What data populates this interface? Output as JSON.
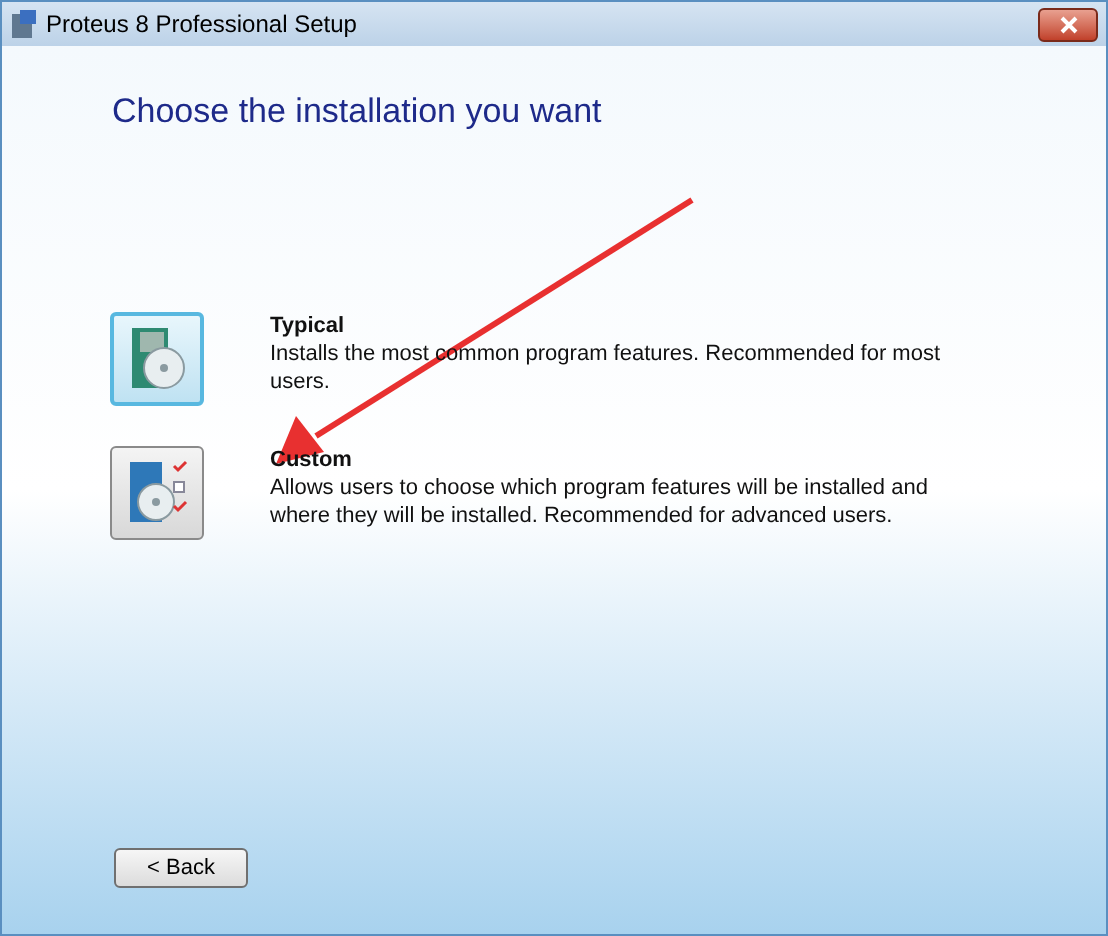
{
  "window": {
    "title": "Proteus 8 Professional Setup"
  },
  "heading": "Choose the installation you want",
  "options": [
    {
      "kind": "typical",
      "title": "Typical",
      "description": "Installs the most common program features. Recommended for most users.",
      "selected": true
    },
    {
      "kind": "custom",
      "title": "Custom",
      "description": "Allows users to choose which program features will be installed and where they will be installed. Recommended for advanced users.",
      "selected": false
    }
  ],
  "buttons": [
    "< Back"
  ]
}
